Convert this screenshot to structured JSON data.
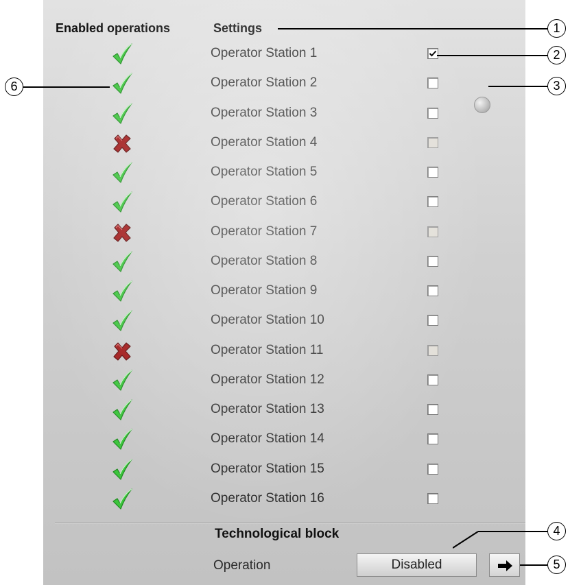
{
  "headers": {
    "enabled_operations": "Enabled operations",
    "settings": "Settings"
  },
  "stations": [
    {
      "label": "Operator Station 1",
      "enabled": true,
      "checked": true
    },
    {
      "label": "Operator Station 2",
      "enabled": true,
      "checked": false
    },
    {
      "label": "Operator Station 3",
      "enabled": true,
      "checked": false
    },
    {
      "label": "Operator Station 4",
      "enabled": false,
      "checked": false
    },
    {
      "label": "Operator Station 5",
      "enabled": true,
      "checked": false
    },
    {
      "label": "Operator Station 6",
      "enabled": true,
      "checked": false
    },
    {
      "label": "Operator Station 7",
      "enabled": false,
      "checked": false
    },
    {
      "label": "Operator Station 8",
      "enabled": true,
      "checked": false
    },
    {
      "label": "Operator Station 9",
      "enabled": true,
      "checked": false
    },
    {
      "label": "Operator Station 10",
      "enabled": true,
      "checked": false
    },
    {
      "label": "Operator Station 11",
      "enabled": false,
      "checked": false
    },
    {
      "label": "Operator Station 12",
      "enabled": true,
      "checked": false
    },
    {
      "label": "Operator Station 13",
      "enabled": true,
      "checked": false
    },
    {
      "label": "Operator Station 14",
      "enabled": true,
      "checked": false
    },
    {
      "label": "Operator Station 15",
      "enabled": true,
      "checked": false
    },
    {
      "label": "Operator Station 16",
      "enabled": true,
      "checked": false
    }
  ],
  "icons": {
    "enabled": "checkmark-icon",
    "disabled": "cross-icon",
    "indicator": "status-indicator-icon",
    "arrow": "right-arrow-icon"
  },
  "colors": {
    "check_green": "#3cc43c",
    "cross_red": "#a01818"
  },
  "technological_block": {
    "title": "Technological block",
    "operation_label": "Operation",
    "operation_value": "Disabled"
  },
  "callouts": [
    "1",
    "2",
    "3",
    "4",
    "5",
    "6"
  ]
}
